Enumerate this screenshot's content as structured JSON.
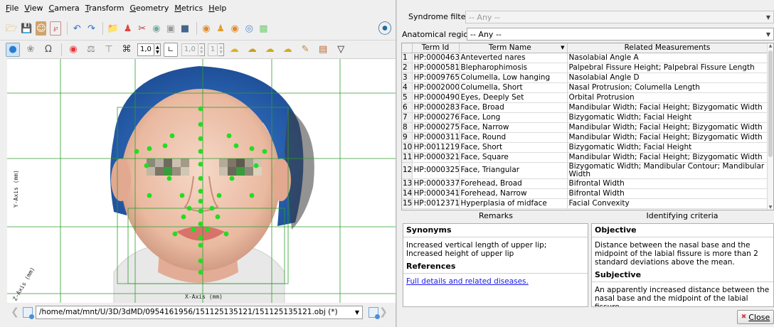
{
  "menu": [
    "File",
    "View",
    "Camera",
    "Transform",
    "Geometry",
    "Metrics",
    "Help"
  ],
  "toolbar": {
    "primary_icons": [
      "open-folder-icon",
      "save-icon",
      "face-model-icon",
      "pdf-icon",
      "undo-icon",
      "redo-icon",
      "folder-icon",
      "figure-icon",
      "scissors-icon",
      "palette-icon",
      "crop-icon",
      "cube-icon",
      "camera-front-icon",
      "camera-left-icon",
      "camera-right-icon",
      "camera-top-icon",
      "camera-side-icon",
      "app-logo-icon"
    ],
    "spin_value": "1,0",
    "spin_value_2": "1,0",
    "spin_value_3": "1"
  },
  "viewport": {
    "y_axis_label": "Y-Axis (mm)",
    "x_axis_label": "X-Axis (mm)",
    "z_axis_label": "Z-Axis (mm)"
  },
  "path_bar": {
    "path": "/home/mat/mnt/U/3D/3dMD/0954161956/151125135121/151125135121.obj (*)"
  },
  "filters": {
    "syndrome_label": "Syndrome filter",
    "syndrome_value": "-- Any --",
    "region_label": "Anatomical region",
    "region_value": "-- Any --"
  },
  "table": {
    "headers": [
      "Term Id",
      "Term Name",
      "Related Measurements"
    ],
    "rows": [
      {
        "n": "1",
        "id": "HP:0000463",
        "name": "Anteverted nares",
        "meas": "Nasolabial Angle A"
      },
      {
        "n": "2",
        "id": "HP:0000581",
        "name": "Blepharophimosis",
        "meas": "Palpebral Fissure Height; Palpebral Fissure Length"
      },
      {
        "n": "3",
        "id": "HP:0009765",
        "name": "Columella, Low hanging",
        "meas": "Nasolabial Angle D"
      },
      {
        "n": "4",
        "id": "HP:0002000",
        "name": "Columella, Short",
        "meas": "Nasal Protrusion; Columella Length"
      },
      {
        "n": "5",
        "id": "HP:0000490",
        "name": "Eyes, Deeply Set",
        "meas": "Orbital Protrusion"
      },
      {
        "n": "6",
        "id": "HP:0000283",
        "name": "Face, Broad",
        "meas": "Mandibular Width; Facial Height; Bizygomatic Width"
      },
      {
        "n": "7",
        "id": "HP:0000276",
        "name": "Face, Long",
        "meas": "Bizygomatic Width; Facial Height"
      },
      {
        "n": "8",
        "id": "HP:0000275",
        "name": "Face, Narrow",
        "meas": "Mandibular Width; Facial Height; Bizygomatic Width"
      },
      {
        "n": "9",
        "id": "HP:0000311",
        "name": "Face, Round",
        "meas": "Mandibular Width; Facial Height; Bizygomatic Width"
      },
      {
        "n": "10",
        "id": "HP:0011219",
        "name": "Face, Short",
        "meas": "Bizygomatic Width; Facial Height"
      },
      {
        "n": "11",
        "id": "HP:0000321",
        "name": "Face, Square",
        "meas": "Mandibular Width; Facial Height; Bizygomatic Width"
      },
      {
        "n": "12",
        "id": "HP:0000325",
        "name": "Face, Triangular",
        "meas": "Bizygomatic Width; Mandibular Contour; Mandibular Width"
      },
      {
        "n": "13",
        "id": "HP:0000337",
        "name": "Forehead, Broad",
        "meas": "Bifrontal Width"
      },
      {
        "n": "14",
        "id": "HP:0000341",
        "name": "Forehead, Narrow",
        "meas": "Bifrontal Width"
      },
      {
        "n": "15",
        "id": "HP:0012371",
        "name": "Hyperplasia of midface",
        "meas": "Facial Convexity"
      }
    ]
  },
  "remarks": {
    "header": "Remarks",
    "synonyms_title": "Synonyms",
    "synonyms_text": "Increased vertical length of upper lip; Increased height of upper lip",
    "references_title": "References",
    "references_link": "Full details and related diseases."
  },
  "criteria": {
    "header": "Identifying criteria",
    "objective_title": "Objective",
    "objective_text": "Distance between the nasal base and the midpoint of the labial fissure is more than 2 standard deviations above the mean.",
    "subjective_title": "Subjective",
    "subjective_text": "An apparently increased distance between the nasal base and the midpoint of the labial fissure."
  },
  "close_label": "Close",
  "colors": {
    "landmark": "#22dd22",
    "grid_line": "#2e9e2e",
    "hair_net": "#2f73c8",
    "skin": "#efc4ae"
  }
}
